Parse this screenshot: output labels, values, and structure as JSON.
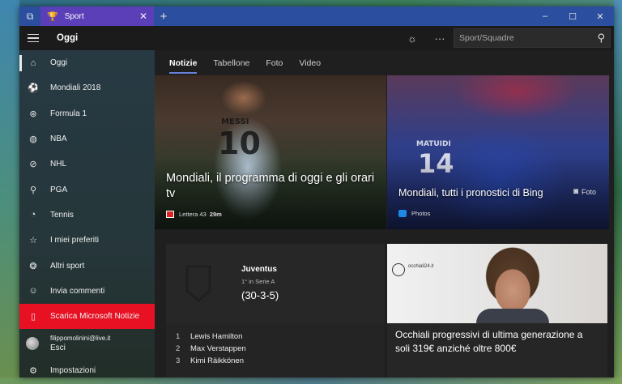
{
  "window": {
    "tab_title": "Sport",
    "controls": {
      "minimize": "–",
      "maximize": "☐",
      "close": "✕"
    }
  },
  "appbar": {
    "title": "Oggi",
    "search_placeholder": "Sport/Squadre"
  },
  "sidebar": {
    "items": [
      {
        "label": "Oggi",
        "icon": "home-icon"
      },
      {
        "label": "Mondiali 2018",
        "icon": "soccer-ball-icon"
      },
      {
        "label": "Formula 1",
        "icon": "steering-wheel-icon"
      },
      {
        "label": "NBA",
        "icon": "basketball-icon"
      },
      {
        "label": "NHL",
        "icon": "hockey-icon"
      },
      {
        "label": "PGA",
        "icon": "golf-icon"
      },
      {
        "label": "Tennis",
        "icon": "tennis-icon"
      },
      {
        "label": "I miei preferiti",
        "icon": "favorites-icon"
      },
      {
        "label": "Altri sport",
        "icon": "other-sports-icon"
      },
      {
        "label": "Invia commenti",
        "icon": "feedback-icon"
      }
    ],
    "promo": {
      "label": "Scarica Microsoft Notizie",
      "icon": "phone-icon"
    },
    "account": {
      "email": "filippomolinini@live.it",
      "action": "Esci"
    },
    "settings": {
      "label": "Impostazioni",
      "icon": "gear-icon"
    }
  },
  "tabs": [
    "Notizie",
    "Tabellone",
    "Foto",
    "Video"
  ],
  "hero_left": {
    "title": "Mondiali, il programma di oggi e gli orari tv",
    "source": "Lettera 43",
    "time": "29m",
    "jersey_name": "MESSI",
    "jersey_number": "10"
  },
  "hero_right": {
    "title": "Mondiali, tutti i pronostici di Bing",
    "source": "Photos",
    "tag": "Foto",
    "jersey_name": "MATUIDI",
    "jersey_number": "14"
  },
  "team": {
    "name": "Juventus",
    "rank": "1° in Serie A",
    "record": "(30-3-5)"
  },
  "standings": [
    {
      "pos": "1",
      "name": "Lewis Hamilton"
    },
    {
      "pos": "2",
      "name": "Max Verstappen"
    },
    {
      "pos": "3",
      "name": "Kimi Räikkönen"
    }
  ],
  "news": {
    "title": "Occhiali progressivi di ultima generazione a soli 319€ anziché oltre 800€",
    "image_text": "occhiali24.it"
  }
}
